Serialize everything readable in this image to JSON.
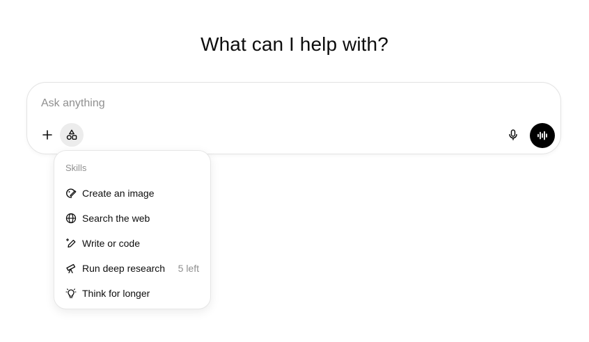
{
  "headline": "What can I help with?",
  "composer": {
    "placeholder": "Ask anything",
    "value": ""
  },
  "toolbar": {
    "plus_icon": "plus-icon",
    "skills_icon": "shapes-icon",
    "mic_icon": "microphone-icon",
    "voice_icon": "voice-waveform-icon"
  },
  "skills_menu": {
    "header": "Skills",
    "items": [
      {
        "label": "Create an image",
        "icon": "image-brush-icon",
        "meta": ""
      },
      {
        "label": "Search the web",
        "icon": "globe-icon",
        "meta": ""
      },
      {
        "label": "Write or code",
        "icon": "pencil-sparkle-icon",
        "meta": ""
      },
      {
        "label": "Run deep research",
        "icon": "telescope-icon",
        "meta": "5 left"
      },
      {
        "label": "Think for longer",
        "icon": "lightbulb-icon",
        "meta": ""
      }
    ]
  },
  "colors": {
    "text": "#0d0d0d",
    "muted": "#8f8f8f",
    "border": "#e3e3e3",
    "voice_button": "#000000",
    "skills_button_bg": "#ececec"
  }
}
